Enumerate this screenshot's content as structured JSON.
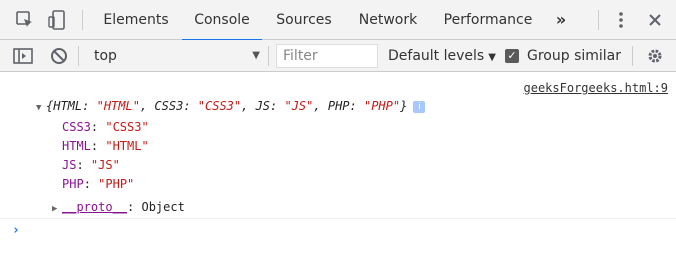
{
  "tabs": [
    {
      "label": "Elements",
      "active": false
    },
    {
      "label": "Console",
      "active": true
    },
    {
      "label": "Sources",
      "active": false
    },
    {
      "label": "Network",
      "active": false
    },
    {
      "label": "Performance",
      "active": false
    }
  ],
  "more_tabs_label": "»",
  "toolbar": {
    "context": "top",
    "filter_placeholder": "Filter",
    "levels_label": "Default levels",
    "group_similar_label": "Group similar",
    "group_similar_checked": true
  },
  "console": {
    "source_link": "geeksForgeeks.html:9",
    "summary": {
      "open_brace": "{",
      "entries": [
        {
          "key": "HTML",
          "value": "\"HTML\""
        },
        {
          "key": "CSS3",
          "value": "\"CSS3\""
        },
        {
          "key": "JS",
          "value": "\"JS\""
        },
        {
          "key": "PHP",
          "value": "\"PHP\""
        }
      ],
      "close_brace": "}",
      "info_badge": "i"
    },
    "properties": [
      {
        "key": "CSS3",
        "value": "\"CSS3\""
      },
      {
        "key": "HTML",
        "value": "\"HTML\""
      },
      {
        "key": "JS",
        "value": "\"JS\""
      },
      {
        "key": "PHP",
        "value": "\"PHP\""
      }
    ],
    "proto": {
      "key": "__proto__",
      "value": "Object"
    }
  },
  "colors": {
    "accent": "#1a73e8",
    "key": "#881391",
    "string": "#c41a16"
  },
  "icons": [
    "inspect-icon",
    "device-toggle-icon",
    "more-tabs-icon",
    "kebab-menu-icon",
    "close-icon",
    "sidebar-toggle-icon",
    "clear-console-icon",
    "settings-gear-icon",
    "prompt-chevron-icon"
  ]
}
